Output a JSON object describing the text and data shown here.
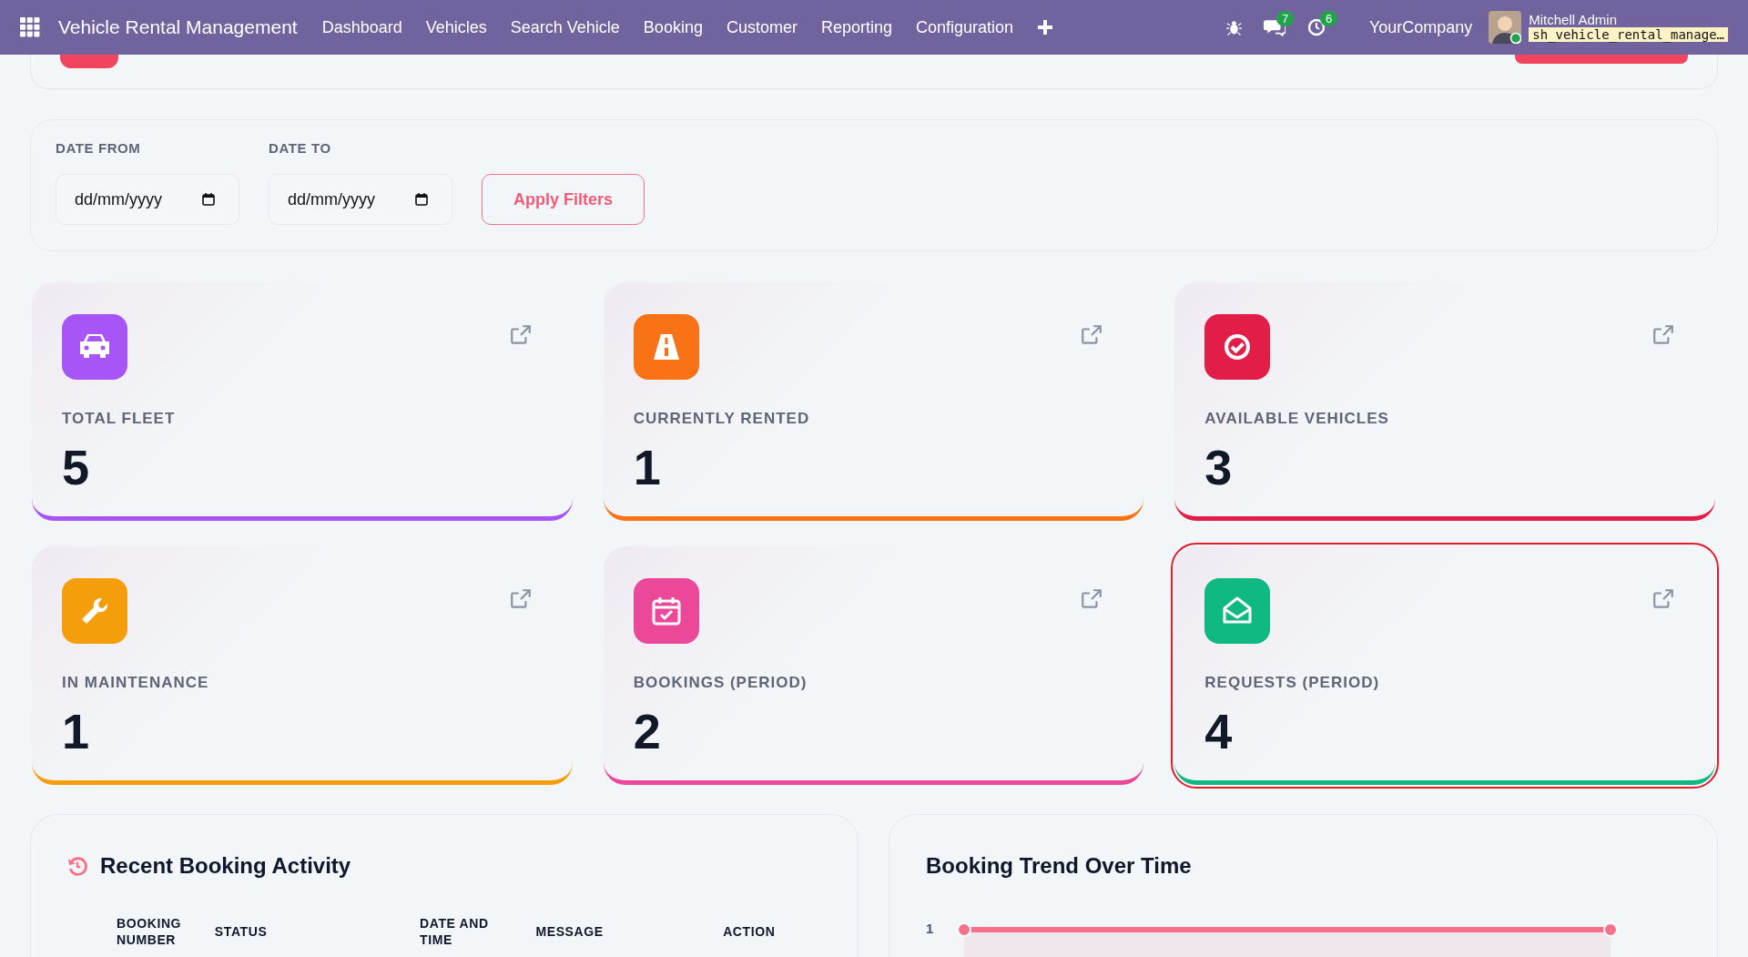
{
  "navbar": {
    "app_title": "Vehicle Rental Management",
    "menu": [
      "Dashboard",
      "Vehicles",
      "Search Vehicle",
      "Booking",
      "Customer",
      "Reporting",
      "Configuration"
    ],
    "messages_count": "7",
    "activities_count": "6",
    "company": "YourCompany",
    "user_name": "Mitchell Admin",
    "database": "sh_vehicle_rental_manage…"
  },
  "filters": {
    "fields": [
      {
        "label": "DATE FROM",
        "placeholder": "dd/mm/yyyy"
      },
      {
        "label": "DATE TO",
        "placeholder": "dd/mm/yyyy"
      }
    ],
    "apply_button": "Apply Filters"
  },
  "cards": [
    {
      "kind": "car",
      "label": "TOTAL FLEET",
      "value": "5",
      "color": "#a855f7",
      "highlighted": false
    },
    {
      "kind": "road",
      "label": "CURRENTLY RENTED",
      "value": "1",
      "color": "#f97316",
      "highlighted": false
    },
    {
      "kind": "check",
      "label": "AVAILABLE VEHICLES",
      "value": "3",
      "color": "#e11d48",
      "highlighted": false
    },
    {
      "kind": "wrench",
      "label": "IN MAINTENANCE",
      "value": "1",
      "color": "#f59e0b",
      "highlighted": false
    },
    {
      "kind": "calendar",
      "label": "BOOKINGS (PERIOD)",
      "value": "2",
      "color": "#ec4899",
      "highlighted": false
    },
    {
      "kind": "envelope",
      "label": "REQUESTS (PERIOD)",
      "value": "4",
      "color": "#10b981",
      "highlighted": true
    }
  ],
  "recent_activity": {
    "title": "Recent Booking Activity",
    "columns": [
      "BOOKING NUMBER",
      "STATUS",
      "DATE AND TIME",
      "MESSAGE",
      "ACTION"
    ]
  },
  "trend": {
    "title": "Booking Trend Over Time",
    "y_axis_label": "1"
  }
}
